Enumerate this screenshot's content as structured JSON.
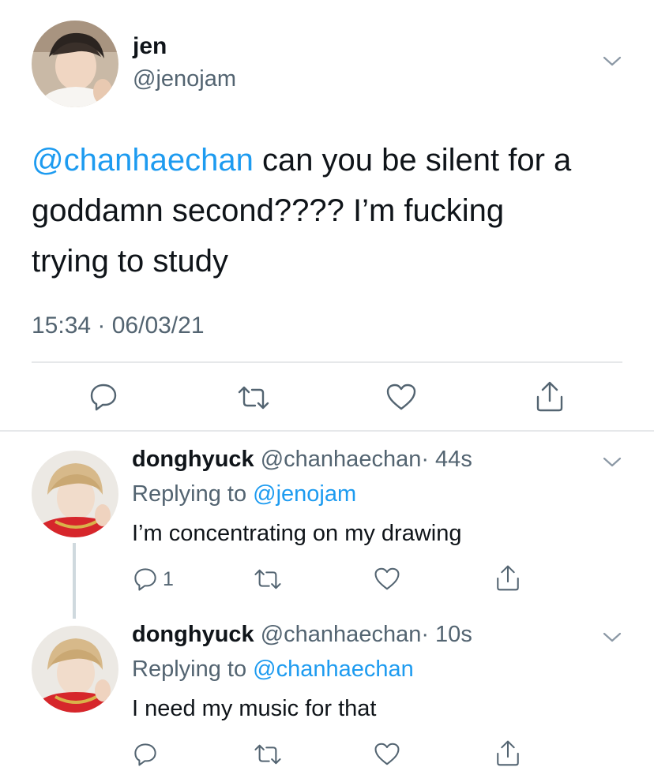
{
  "main_tweet": {
    "display_name": "jen",
    "handle": "@jenojam",
    "mention": "@chanhaechan",
    "text_line1": " can you be silent for a",
    "text_line2": "goddamn second???? I’m fucking",
    "text_line3": "trying to study",
    "timestamp": "15:34 · 06/03/21"
  },
  "replies": [
    {
      "display_name": "donghyuck",
      "handle": "@chanhaechan",
      "time": "· 44s",
      "replying_prefix": "Replying to ",
      "replying_to": "@jenojam",
      "text": "I’m concentrating on my drawing",
      "reply_count": "1"
    },
    {
      "display_name": "donghyuck",
      "handle": "@chanhaechan",
      "time": "· 10s",
      "replying_prefix": "Replying to ",
      "replying_to": "@chanhaechan",
      "text": "I need my music for that",
      "reply_count": ""
    }
  ],
  "icons": {
    "chevron": "chevron-down-icon",
    "reply": "reply-icon",
    "retweet": "retweet-icon",
    "like": "heart-icon",
    "share": "share-icon"
  },
  "colors": {
    "link_blue": "#1d9bf0",
    "secondary_gray": "#536471",
    "divider": "#e6e8ea"
  }
}
